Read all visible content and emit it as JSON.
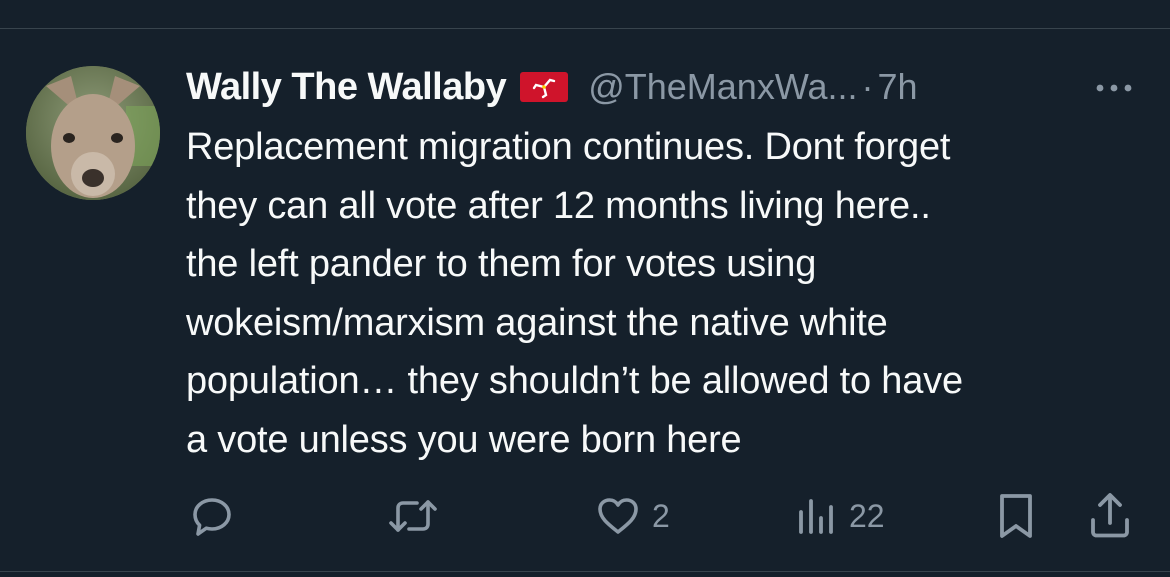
{
  "tweet": {
    "author": {
      "display_name": "Wally The Wallaby",
      "handle": "@TheManxWa...",
      "flag_icon": "isle-of-man-flag-icon"
    },
    "separator": "·",
    "time": "7h",
    "text_lines": [
      "Replacement migration continues. Dont forget",
      "they can all vote after 12 months living here..",
      "the left pander to them for votes using",
      "wokeism/marxism against the native white",
      "population… they shouldn’t be allowed to have",
      "a vote unless you were born here"
    ],
    "actions": {
      "reply": {
        "icon": "reply-icon"
      },
      "retweet": {
        "icon": "retweet-icon"
      },
      "like": {
        "icon": "heart-icon",
        "count": "2"
      },
      "views": {
        "icon": "views-icon",
        "count": "22"
      },
      "bookmark": {
        "icon": "bookmark-icon"
      },
      "share": {
        "icon": "share-icon"
      }
    }
  },
  "colors": {
    "background": "#15202b",
    "text_primary": "#f7f9f9",
    "text_secondary": "#8b98a5",
    "divider": "#38444d",
    "flag_red": "#cf142b"
  }
}
